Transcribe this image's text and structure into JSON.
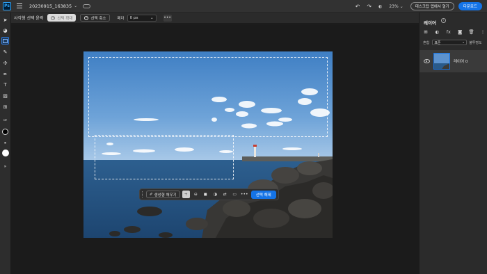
{
  "app": {
    "logo": "Ps",
    "doc_title": "20230915_163835"
  },
  "topbar": {
    "zoom": "23%",
    "share_label": "데스크탑 앱에서 열기",
    "download_label": "다운로드",
    "icons": [
      "menu-icon",
      "chevron-down-icon",
      "cloud-icon",
      "undo-icon",
      "redo-icon",
      "zoom-icon",
      "chevron-down-icon"
    ]
  },
  "options": {
    "tool_label": "사각형 선택 윤곽",
    "expand_label": "선택 확대",
    "shrink_label": "선택 축소",
    "feather_label": "페더",
    "feather_value": "0 px",
    "more": "•••"
  },
  "tools": [
    "move-tool-icon",
    "lasso-tool-icon",
    "marquee-tool-icon",
    "brush-tool-icon",
    "healing-tool-icon",
    "pen-tool-icon",
    "type-tool-icon",
    "crop-tool-icon",
    "stamp-tool-icon",
    "eyedropper-tool-icon",
    "foreground-color",
    "swap-icon",
    "background-color",
    "expand-icon"
  ],
  "taskbar": {
    "generative_label": "생성형 채우기",
    "more": "•••",
    "deselect_label": "선택 해제"
  },
  "layers": {
    "title": "레이어",
    "blend_label": "혼합",
    "blend_value": "표준",
    "opacity_label": "불투명도",
    "items": [
      {
        "name": "레이어 0",
        "visible": true,
        "selected": true
      }
    ]
  },
  "colors": {
    "accent": "#1473e6",
    "foreground": "#000000",
    "background": "#ffffff"
  }
}
